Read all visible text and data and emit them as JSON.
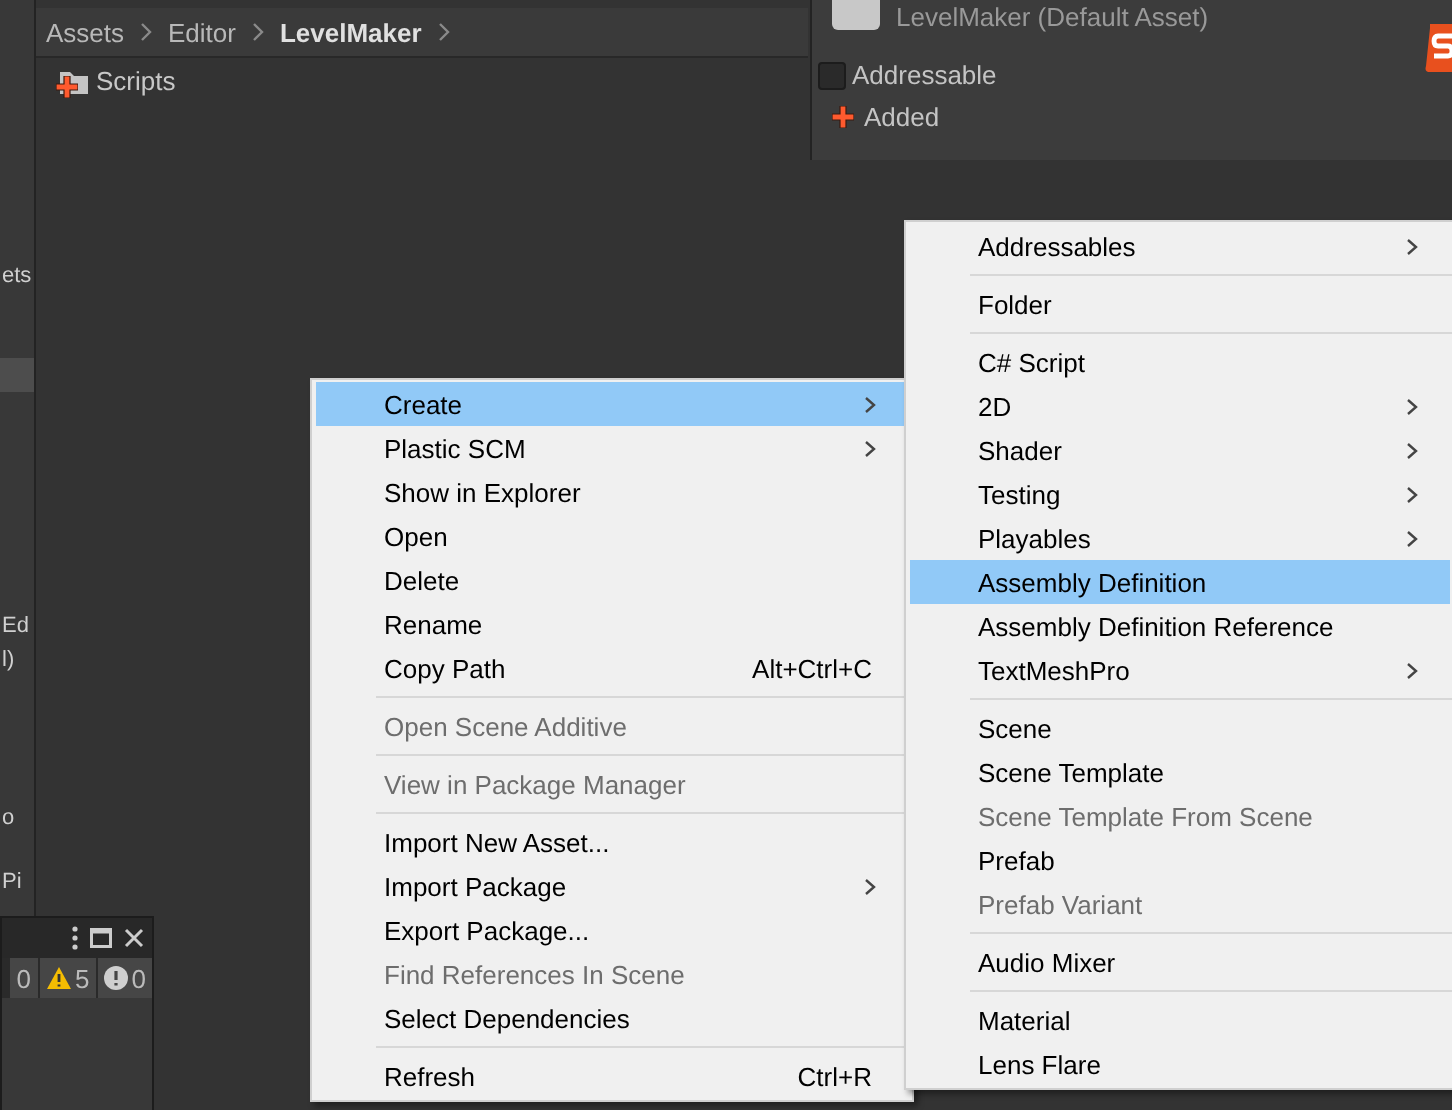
{
  "left_panel": {
    "fragments": [
      "ets",
      "Ed",
      "l)",
      "o",
      "Pi"
    ]
  },
  "project": {
    "breadcrumb": [
      {
        "label": "Assets",
        "current": false
      },
      {
        "label": "Editor",
        "current": false
      },
      {
        "label": "LevelMaker",
        "current": true
      }
    ],
    "items": [
      {
        "label": "Scripts",
        "added": true
      }
    ]
  },
  "inspector": {
    "title": "LevelMaker (Default Asset)",
    "addressable": {
      "label": "Addressable",
      "checked": false
    },
    "status": "Added"
  },
  "console": {
    "counts": [
      {
        "kind": "log",
        "count": "0"
      },
      {
        "kind": "warning",
        "count": "5"
      },
      {
        "kind": "error",
        "count": "0"
      }
    ]
  },
  "context_menu": [
    {
      "kind": "item",
      "label": "Create",
      "submenu": true,
      "selected": true,
      "disabled": false
    },
    {
      "kind": "item",
      "label": "Plastic SCM",
      "submenu": true,
      "selected": false,
      "disabled": false
    },
    {
      "kind": "item",
      "label": "Show in Explorer",
      "submenu": false,
      "selected": false,
      "disabled": false
    },
    {
      "kind": "item",
      "label": "Open",
      "submenu": false,
      "selected": false,
      "disabled": false
    },
    {
      "kind": "item",
      "label": "Delete",
      "submenu": false,
      "selected": false,
      "disabled": false
    },
    {
      "kind": "item",
      "label": "Rename",
      "submenu": false,
      "selected": false,
      "disabled": false
    },
    {
      "kind": "item",
      "label": "Copy Path",
      "shortcut": "Alt+Ctrl+C",
      "submenu": false,
      "selected": false,
      "disabled": false
    },
    {
      "kind": "separator"
    },
    {
      "kind": "item",
      "label": "Open Scene Additive",
      "submenu": false,
      "selected": false,
      "disabled": true
    },
    {
      "kind": "separator"
    },
    {
      "kind": "item",
      "label": "View in Package Manager",
      "submenu": false,
      "selected": false,
      "disabled": true
    },
    {
      "kind": "separator"
    },
    {
      "kind": "item",
      "label": "Import New Asset...",
      "submenu": false,
      "selected": false,
      "disabled": false
    },
    {
      "kind": "item",
      "label": "Import Package",
      "submenu": true,
      "selected": false,
      "disabled": false
    },
    {
      "kind": "item",
      "label": "Export Package...",
      "submenu": false,
      "selected": false,
      "disabled": false
    },
    {
      "kind": "item",
      "label": "Find References In Scene",
      "submenu": false,
      "selected": false,
      "disabled": true
    },
    {
      "kind": "item",
      "label": "Select Dependencies",
      "submenu": false,
      "selected": false,
      "disabled": false
    },
    {
      "kind": "separator"
    },
    {
      "kind": "item",
      "label": "Refresh",
      "shortcut": "Ctrl+R",
      "submenu": false,
      "selected": false,
      "disabled": false
    }
  ],
  "create_submenu": [
    {
      "kind": "item",
      "label": "Addressables",
      "submenu": true,
      "selected": false,
      "disabled": false
    },
    {
      "kind": "separator"
    },
    {
      "kind": "item",
      "label": "Folder",
      "submenu": false,
      "selected": false,
      "disabled": false
    },
    {
      "kind": "separator"
    },
    {
      "kind": "item",
      "label": "C# Script",
      "submenu": false,
      "selected": false,
      "disabled": false
    },
    {
      "kind": "item",
      "label": "2D",
      "submenu": true,
      "selected": false,
      "disabled": false
    },
    {
      "kind": "item",
      "label": "Shader",
      "submenu": true,
      "selected": false,
      "disabled": false
    },
    {
      "kind": "item",
      "label": "Testing",
      "submenu": true,
      "selected": false,
      "disabled": false
    },
    {
      "kind": "item",
      "label": "Playables",
      "submenu": true,
      "selected": false,
      "disabled": false
    },
    {
      "kind": "item",
      "label": "Assembly Definition",
      "submenu": false,
      "selected": true,
      "disabled": false
    },
    {
      "kind": "item",
      "label": "Assembly Definition Reference",
      "submenu": false,
      "selected": false,
      "disabled": false
    },
    {
      "kind": "item",
      "label": "TextMeshPro",
      "submenu": true,
      "selected": false,
      "disabled": false
    },
    {
      "kind": "separator"
    },
    {
      "kind": "item",
      "label": "Scene",
      "submenu": false,
      "selected": false,
      "disabled": false
    },
    {
      "kind": "item",
      "label": "Scene Template",
      "submenu": false,
      "selected": false,
      "disabled": false
    },
    {
      "kind": "item",
      "label": "Scene Template From Scene",
      "submenu": false,
      "selected": false,
      "disabled": true
    },
    {
      "kind": "item",
      "label": "Prefab",
      "submenu": false,
      "selected": false,
      "disabled": false
    },
    {
      "kind": "item",
      "label": "Prefab Variant",
      "submenu": false,
      "selected": false,
      "disabled": true
    },
    {
      "kind": "separator"
    },
    {
      "kind": "item",
      "label": "Audio Mixer",
      "submenu": false,
      "selected": false,
      "disabled": false
    },
    {
      "kind": "separator"
    },
    {
      "kind": "item",
      "label": "Material",
      "submenu": false,
      "selected": false,
      "disabled": false
    },
    {
      "kind": "item",
      "label": "Lens Flare",
      "submenu": false,
      "selected": false,
      "disabled": false
    }
  ]
}
